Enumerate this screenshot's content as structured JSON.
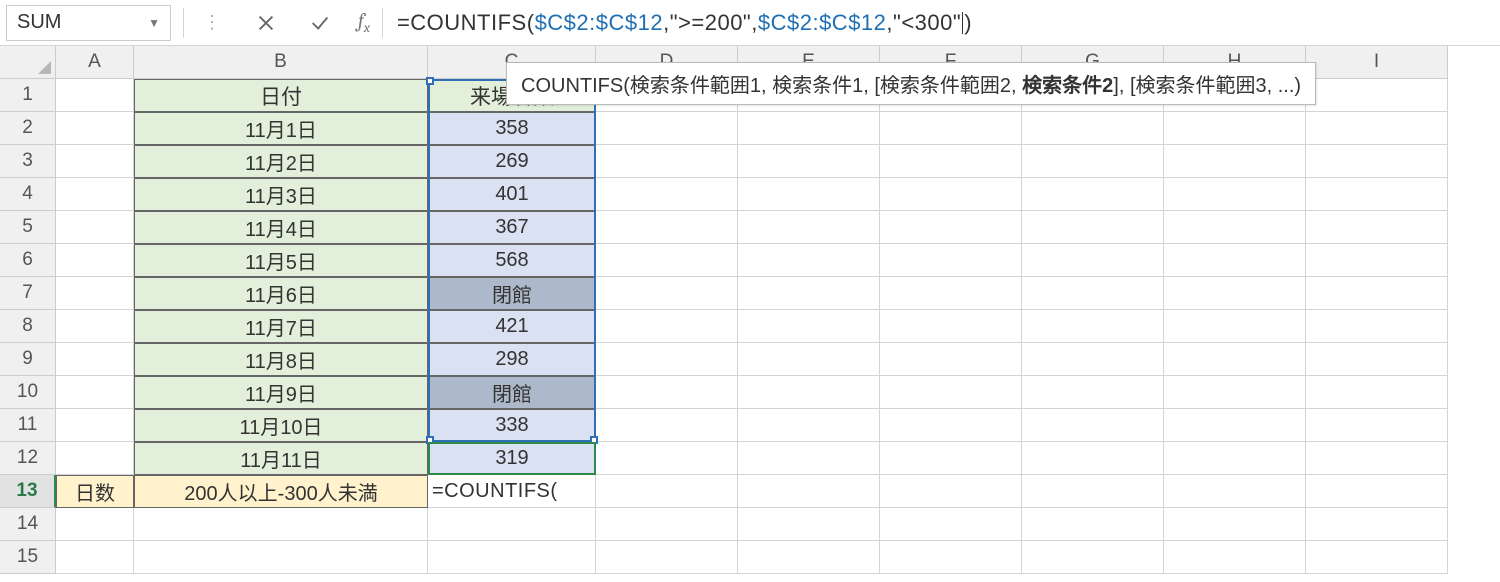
{
  "namebox": "SUM",
  "formula": {
    "prefix": "=COUNTIFS(",
    "ref1": "$C$2:$C$12",
    "lit1": ",\">=200\",",
    "ref2": "$C$2:$C$12",
    "lit2": ",\"<300\"",
    "suffix": ")"
  },
  "tooltip": {
    "pre": "COUNTIFS(検索条件範囲1, 検索条件1, [検索条件範囲2, ",
    "bold": "検索条件2",
    "post": "], [検索条件範囲3, ...)"
  },
  "columns": [
    "A",
    "B",
    "C",
    "D",
    "E",
    "F",
    "G",
    "H",
    "I"
  ],
  "headers": {
    "b": "日付",
    "c": "来場者数"
  },
  "rows": [
    {
      "n": "1",
      "type": "header"
    },
    {
      "n": "2",
      "date": "11月1日",
      "val": "358",
      "vtype": "num"
    },
    {
      "n": "3",
      "date": "11月2日",
      "val": "269",
      "vtype": "num"
    },
    {
      "n": "4",
      "date": "11月3日",
      "val": "401",
      "vtype": "num"
    },
    {
      "n": "5",
      "date": "11月4日",
      "val": "367",
      "vtype": "num"
    },
    {
      "n": "6",
      "date": "11月5日",
      "val": "568",
      "vtype": "num"
    },
    {
      "n": "7",
      "date": "11月6日",
      "val": "閉館",
      "vtype": "closed"
    },
    {
      "n": "8",
      "date": "11月7日",
      "val": "421",
      "vtype": "num"
    },
    {
      "n": "9",
      "date": "11月8日",
      "val": "298",
      "vtype": "num"
    },
    {
      "n": "10",
      "date": "11月9日",
      "val": "閉館",
      "vtype": "closed"
    },
    {
      "n": "11",
      "date": "11月10日",
      "val": "338",
      "vtype": "num"
    },
    {
      "n": "12",
      "date": "11月11日",
      "val": "319",
      "vtype": "num"
    }
  ],
  "row13": {
    "a": "日数",
    "b": "200人以上-300人未満",
    "c": "=COUNTIFS("
  },
  "extra_rows": [
    "14",
    "15"
  ]
}
